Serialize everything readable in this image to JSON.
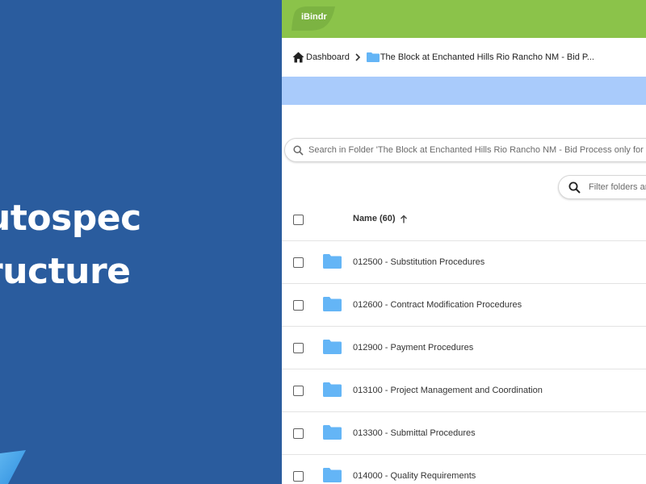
{
  "promo": {
    "title_line1": "utospec",
    "title_line2": "ructure",
    "background": "#2a5c9e"
  },
  "app": {
    "logo": "iBindr",
    "brand_color": "#8bc34a",
    "breadcrumb": {
      "home_icon": "home-icon",
      "root": "Dashboard",
      "current": "The Block at Enchanted Hills Rio Rancho NM - Bid P..."
    },
    "search": {
      "placeholder": "Search in Folder 'The Block at Enchanted Hills Rio Rancho NM - Bid Process only for Jayne"
    },
    "filter": {
      "placeholder": "Filter folders an"
    },
    "table": {
      "header": "Name (60)",
      "sort_icon": "arrow-up-icon",
      "rows": [
        "012500 - Substitution Procedures",
        "012600 - Contract Modification Procedures",
        "012900 - Payment Procedures",
        "013100 - Project Management and Coordination",
        "013300 - Submittal Procedures",
        "014000 - Quality Requirements"
      ]
    },
    "folder_color": "#64b5f6"
  }
}
